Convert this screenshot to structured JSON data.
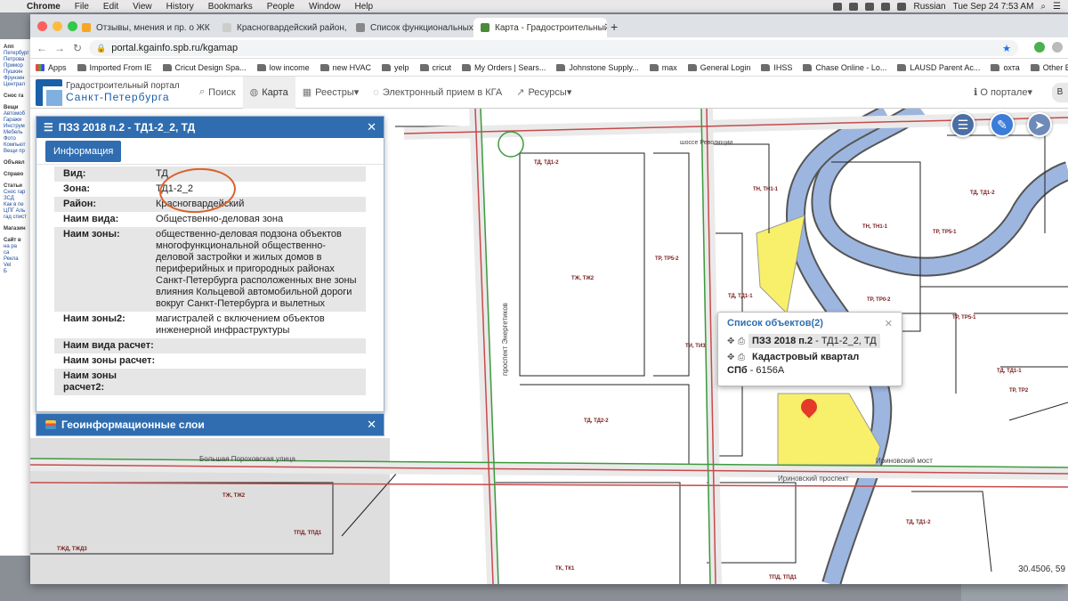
{
  "menubar": {
    "app": "Chrome",
    "items": [
      "File",
      "Edit",
      "View",
      "History",
      "Bookmarks",
      "People",
      "Window",
      "Help"
    ],
    "input_source": "Russian",
    "clock": "Tue Sep 24  7:53 AM"
  },
  "tabs": [
    {
      "title": "Отзывы, мнения и пр. о ЖК",
      "color": "#f5a623"
    },
    {
      "title": "Красногвардейский район, с",
      "color": "#cccccc"
    },
    {
      "title": "Список функциональных зон",
      "color": "#888888"
    },
    {
      "title": "Карта - Градостроительный п",
      "color": "#4a8a3a"
    }
  ],
  "address": {
    "url": "portal.kgainfo.spb.ru/kgamap"
  },
  "bookmarks": [
    "Apps",
    "Imported From IE",
    "Cricut Design Spa...",
    "low income",
    "new HVAC",
    "yelp",
    "cricut",
    "My Orders | Sears...",
    "Johnstone Supply...",
    "max",
    "General Login",
    "IHSS",
    "Chase Online - Lo...",
    "LAUSD Parent Ac...",
    "охта",
    "Other Book"
  ],
  "site": {
    "logo_line1": "Градостроительный портал",
    "logo_line2": "Санкт-Петербурга",
    "nav": [
      {
        "icon": "search-icon",
        "label": "Поиск"
      },
      {
        "icon": "globe-icon",
        "label": "Карта"
      },
      {
        "icon": "table-icon",
        "label": "Реестры"
      },
      {
        "icon": "chat-icon",
        "label": "Электронный прием в КГА"
      },
      {
        "icon": "external-icon",
        "label": "Ресурсы"
      }
    ],
    "portal": "О портале",
    "user": "В"
  },
  "panel": {
    "title": "ПЗЗ 2018 п.2 - ТД1-2_2, ТД",
    "tab": "Информация",
    "rows": [
      {
        "k": "Вид:",
        "v": "ТД"
      },
      {
        "k": "Зона:",
        "v": "ТД1-2_2"
      },
      {
        "k": "Район:",
        "v": "Красногвардейский"
      },
      {
        "k": "Наим вида:",
        "v": "Общественно-деловая зона"
      },
      {
        "k": "Наим зоны:",
        "v": "общественно-деловая подзона объектов многофункциональной общественно-деловой застройки и жилых домов в периферийных и пригородных районах Санкт-Петербурга расположенных вне зоны влияния Кольцевой автомобильной дороги вокруг Санкт-Петербурга и вылетных"
      },
      {
        "k": "Наим зоны2:",
        "v": "магистралей с включением объектов инженерной инфраструктуры"
      },
      {
        "k": "Наим вида расчет:",
        "v": ""
      },
      {
        "k": "Наим зоны расчет:",
        "v": ""
      },
      {
        "k": "Наим зоны расчет2:",
        "v": ""
      }
    ]
  },
  "layers_panel": {
    "title": "Геоинформационные слои"
  },
  "popup": {
    "title": "Список объектов(2)",
    "item1": {
      "bold": "ПЗЗ 2018 п.2",
      "rest": " - ТД1-2_2, ТД"
    },
    "item2": "Кадастровый квартал",
    "item2_sub_bold": "СПб",
    "item2_sub_rest": " - 6156А"
  },
  "map": {
    "coords": "30.4506, 59",
    "streets": [
      "Большая Пороховская улица",
      "Ириновский проспект",
      "Ириновский мост",
      "проспект Энергетиков",
      "шоссе Революции"
    ],
    "zones": [
      {
        "label": "ТД, ТД1-2"
      },
      {
        "label": "ТН, ТН1-1"
      },
      {
        "label": "ТЖ, ТЖ2"
      },
      {
        "label": "ТР, ТР5-2"
      },
      {
        "label": "ТД, ТД1-1"
      },
      {
        "label": "ТН, ТН1-1"
      },
      {
        "label": "ТР, ТР5-1"
      },
      {
        "label": "ТР, ТР0-2"
      },
      {
        "label": "ТД, ТД1-2"
      },
      {
        "label": "ТИ, ТИ3"
      },
      {
        "label": "ТЖ, ТЖ2"
      },
      {
        "label": "ТПД, ТПД1"
      },
      {
        "label": "ТД, ТД2-2"
      },
      {
        "label": "ТК, ТК1"
      },
      {
        "label": "ТПД, ТПД1"
      },
      {
        "label": "ТД, ТД1-2"
      },
      {
        "label": "ТР, ТР5-1"
      },
      {
        "label": "ТД, ТД1-1"
      },
      {
        "label": "ТЖД, ТЖД3"
      },
      {
        "label": "ТР, ТР2"
      }
    ]
  },
  "bg_window": {
    "items": [
      "Апп",
      "Петербург",
      "Петрова",
      "Примор",
      "Пушкин",
      "Фрунзен",
      "Централ",
      "Снос га",
      "Вещи",
      "Автомоб",
      "Гаражи",
      "Инструм",
      "Мебель",
      "Фото",
      "Компьют",
      "Вещи пр",
      "Объявл",
      "Справо",
      "Статьи",
      "Снос гар",
      "ЗСД",
      "Как в пе",
      "ЦПГ Аль",
      "гад спист",
      "Магазин",
      "Сайт в",
      "на ра",
      "са",
      "Рекла",
      "Vel",
      "Б"
    ]
  },
  "colors": {
    "primary": "#2f6db0",
    "highlight": "#d9622b",
    "water": "#9db6e0",
    "yellow_zone": "#f8f06a",
    "road": "#c84a4a"
  }
}
